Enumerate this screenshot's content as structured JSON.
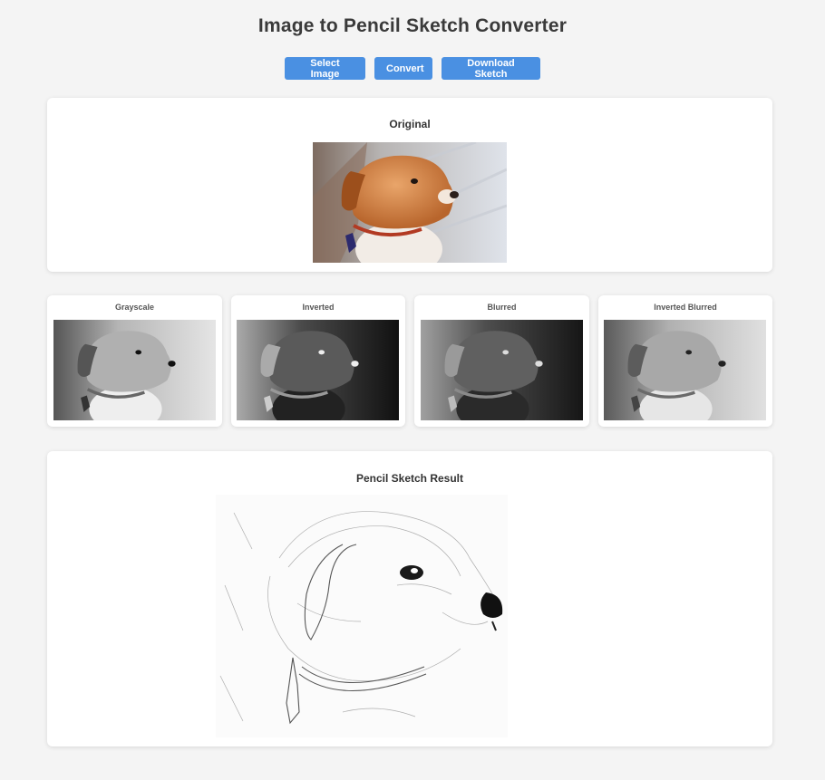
{
  "page": {
    "title": "Image to Pencil Sketch Converter"
  },
  "toolbar": {
    "select_label": "Select Image",
    "convert_label": "Convert",
    "download_label": "Download Sketch"
  },
  "original": {
    "title": "Original"
  },
  "stages": [
    {
      "title": "Grayscale"
    },
    {
      "title": "Inverted"
    },
    {
      "title": "Blurred"
    },
    {
      "title": "Inverted Blurred"
    }
  ],
  "result": {
    "title": "Pencil Sketch Result"
  },
  "colors": {
    "accent": "#4a90e2",
    "background": "#f4f4f4"
  }
}
